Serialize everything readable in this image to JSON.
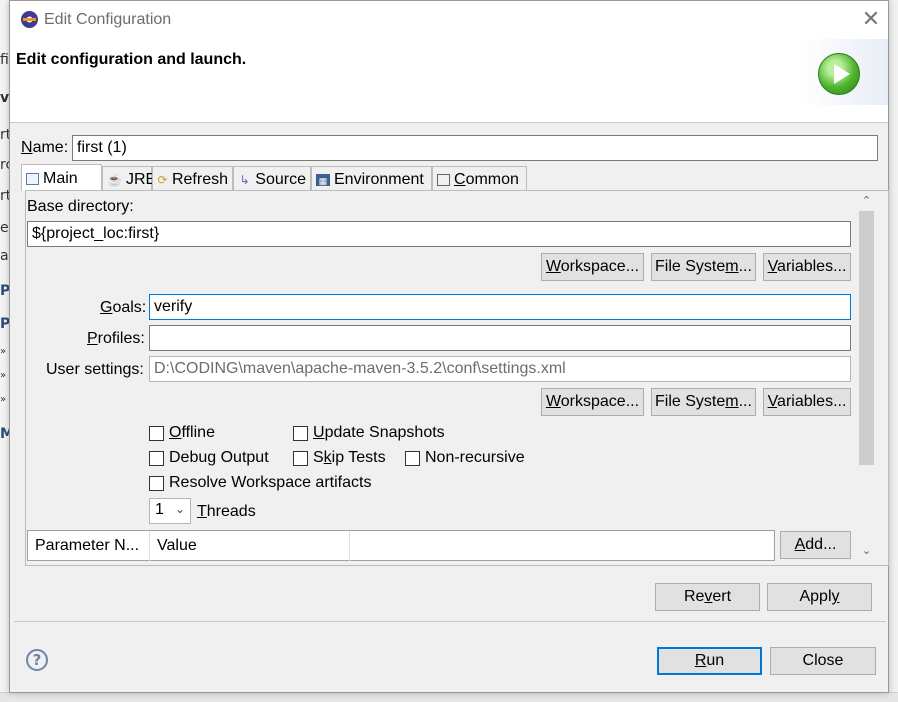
{
  "background_app": {
    "fragments": [
      "fi",
      "v",
      "rt",
      "rc",
      "rt",
      "e",
      "ac",
      "P",
      "P",
      "»",
      "»",
      "»",
      "M"
    ]
  },
  "window": {
    "title": "Edit Configuration",
    "close_glyph": "✕"
  },
  "header": {
    "title": "Edit configuration and launch."
  },
  "name": {
    "label_prefix": "N",
    "label_rest": "ame:",
    "value": "first (1)"
  },
  "tabs": [
    {
      "label": "Main",
      "icon": "main-tab-icon"
    },
    {
      "label": "JRE",
      "icon": "jre-icon"
    },
    {
      "label": "Refresh",
      "icon": "refresh-icon"
    },
    {
      "label": "Source",
      "icon": "source-icon"
    },
    {
      "label": "Environment",
      "icon": "environment-icon"
    },
    {
      "label_prefix": "C",
      "label_rest": "ommon",
      "icon": "common-icon"
    }
  ],
  "main": {
    "base_directory_label": "Base directory:",
    "base_directory_value": "${project_loc:first}",
    "buttons_row1": {
      "workspace": {
        "prefix": "",
        "u": "W",
        "rest": "orkspace..."
      },
      "filesystem": {
        "prefix": "File Syste",
        "u": "m",
        "rest": "..."
      },
      "variables": {
        "prefix": "",
        "u": "V",
        "rest": "ariables..."
      }
    },
    "goals": {
      "label_u": "G",
      "label_rest": "oals:",
      "value": "verify"
    },
    "profiles": {
      "label_prefix": "",
      "label_u": "P",
      "label_rest": "rofiles:",
      "value": ""
    },
    "user_settings": {
      "label": "User settings:",
      "value": "D:\\CODING\\maven\\apache-maven-3.5.2\\conf\\settings.xml"
    },
    "buttons_row2": {
      "workspace": {
        "prefix": "",
        "u": "W",
        "rest": "orkspace..."
      },
      "filesystem": {
        "prefix": "File Syste",
        "u": "m",
        "rest": "..."
      },
      "variables": {
        "prefix": "",
        "u": "V",
        "rest": "ariables..."
      }
    },
    "checkboxes": {
      "offline": {
        "u": "O",
        "rest": "ffline",
        "checked": false
      },
      "update_snapshots": {
        "u": "U",
        "rest": "pdate Snapshots",
        "checked": false
      },
      "debug_output": {
        "prefix": "Debu",
        "u": "g",
        "rest": " Output",
        "checked": false
      },
      "skip_tests": {
        "prefix": "S",
        "u": "k",
        "rest": "ip Tests",
        "checked": false
      },
      "non_recursive": {
        "label": "Non-recursive",
        "checked": false
      },
      "resolve_workspace": {
        "label": "Resolve Workspace artifacts",
        "checked": false
      }
    },
    "threads": {
      "value": "1",
      "label_u": "T",
      "label_rest": "hreads"
    },
    "param_table": {
      "columns": [
        "Parameter N...",
        "Value"
      ]
    },
    "add_button": {
      "u": "A",
      "rest": "dd..."
    }
  },
  "footer": {
    "revert": {
      "prefix": "Re",
      "u": "v",
      "rest": "ert"
    },
    "apply": {
      "prefix": "Appl",
      "u": "y",
      "rest": ""
    },
    "run": {
      "u": "R",
      "rest": "un"
    },
    "close": "Close",
    "help_glyph": "?"
  },
  "colors": {
    "focus": "#0078d7",
    "run_icon": "#4eb52e"
  }
}
